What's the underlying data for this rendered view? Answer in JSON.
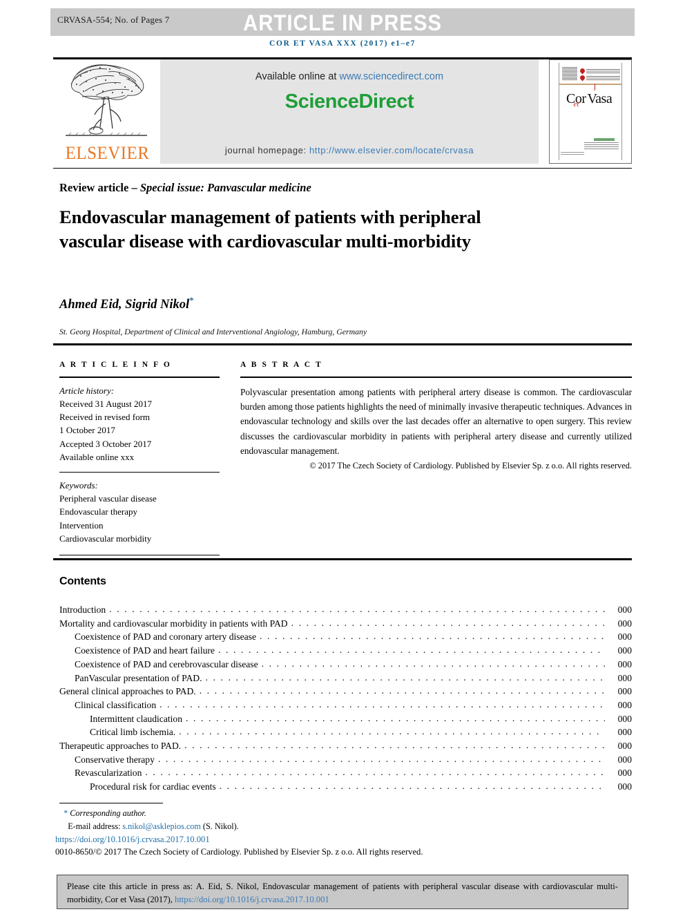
{
  "press_band": {
    "manuscript_id": "CRVASA-554; No. of Pages 7",
    "banner": "ARTICLE IN PRESS"
  },
  "journal_reference": "COR ET VASA XXX (2017) e1–e7",
  "masthead": {
    "publisher_name": "ELSEVIER",
    "available_prefix": "Available online at ",
    "available_link": "www.sciencedirect.com",
    "sciencedirect_logo": "ScienceDirect",
    "homepage_prefix": "journal homepage: ",
    "homepage_link": "http://www.elsevier.com/locate/crvasa",
    "cover": {
      "word_cor": "Cor",
      "word_et": "et",
      "word_vasa": "Vasa"
    }
  },
  "article": {
    "section_label_plain": "Review article – ",
    "section_label_italic": "Special issue: Panvascular medicine",
    "title": "Endovascular management of patients with peripheral vascular disease with cardiovascular multi-morbidity",
    "authors": "Ahmed Eid, Sigrid Nikol",
    "author_footnote_marker": "*",
    "affiliation": "St. Georg Hospital, Department of Clinical and Interventional Angiology, Hamburg, Germany"
  },
  "article_info": {
    "heading": "A R T I C L E   I N F O",
    "history_label": "Article history:",
    "history": [
      "Received 31 August 2017",
      "Received in revised form",
      "1 October 2017",
      "Accepted 3 October 2017",
      "Available online xxx"
    ],
    "keywords_label": "Keywords:",
    "keywords": [
      "Peripheral vascular disease",
      "Endovascular therapy",
      "Intervention",
      "Cardiovascular morbidity"
    ]
  },
  "abstract": {
    "heading": "A B S T R A C T",
    "body": "Polyvascular presentation among patients with peripheral artery disease is common. The cardiovascular burden among those patients highlights the need of minimally invasive therapeutic techniques. Advances in endovascular technology and skills over the last decades offer an alternative to open surgery. This review discusses the cardiovascular morbidity in patients with peripheral artery disease and currently utilized endovascular management.",
    "copyright": "© 2017 The Czech Society of Cardiology. Published by Elsevier Sp. z o.o. All rights reserved."
  },
  "contents": {
    "heading": "Contents",
    "entries": [
      {
        "label": "Introduction",
        "page": "000",
        "level": 1
      },
      {
        "label": "Mortality and cardiovascular morbidity in patients with PAD",
        "page": "000",
        "level": 1
      },
      {
        "label": "Coexistence of PAD and coronary artery disease",
        "page": "000",
        "level": 2
      },
      {
        "label": "Coexistence of PAD and heart failure",
        "page": "000",
        "level": 2
      },
      {
        "label": "Coexistence of PAD and cerebrovascular disease",
        "page": "000",
        "level": 2
      },
      {
        "label": "PanVascular presentation of PAD.",
        "page": "000",
        "level": 2
      },
      {
        "label": "General clinical approaches to PAD.",
        "page": "000",
        "level": 1
      },
      {
        "label": "Clinical classification",
        "page": "000",
        "level": 2
      },
      {
        "label": "Intermittent claudication",
        "page": "000",
        "level": 3
      },
      {
        "label": "Critical limb ischemia.",
        "page": "000",
        "level": 3
      },
      {
        "label": "Therapeutic approaches to PAD.",
        "page": "000",
        "level": 1
      },
      {
        "label": "Conservative therapy",
        "page": "000",
        "level": 2
      },
      {
        "label": "Revascularization",
        "page": "000",
        "level": 2
      },
      {
        "label": "Procedural risk for cardiac events",
        "page": "000",
        "level": 3
      }
    ]
  },
  "footer": {
    "corresponding_marker": "*",
    "corresponding_label": "Corresponding author.",
    "email_label": "E-mail address: ",
    "email": "s.nikol@asklepios.com",
    "email_suffix": " (S. Nikol).",
    "doi": "https://doi.org/10.1016/j.crvasa.2017.10.001",
    "issn_copyright": "0010-8650/© 2017 The Czech Society of Cardiology. Published by Elsevier Sp. z o.o. All rights reserved."
  },
  "cite_box": {
    "text_before_link": "Please cite this article in press as: A. Eid, S. Nikol, Endovascular management of patients with peripheral vascular disease with cardiovascular multi-morbidity, Cor et Vasa (2017), ",
    "link": "https://doi.org/10.1016/j.crvasa.2017.10.001"
  },
  "colors": {
    "band_gray": "#c9c9c9",
    "banner_white": "#ffffff",
    "journal_ref_blue": "#0a5a8c",
    "elsevier_orange": "#e87722",
    "sciencedirect_green": "#1d9e38",
    "link_blue": "#3a7ab5",
    "footnote_link_blue": "#1f6fa8",
    "cite_box_gray": "#c8c8c8",
    "masthead_gray": "#e4e4e4",
    "cover_red": "#c0231f"
  }
}
